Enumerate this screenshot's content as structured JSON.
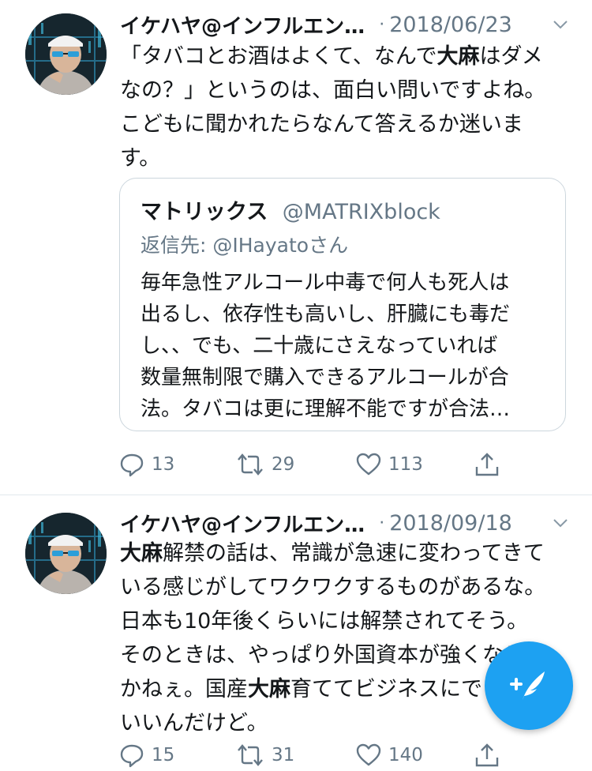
{
  "tweets": [
    {
      "author": "イケハヤ@インフルエン…",
      "sep": "·",
      "date": "2018/06/23",
      "lines": [
        [
          "「タバコとお酒はよくて、なんで",
          "大麻",
          "はダメ"
        ],
        [
          "なの？」というのは、面白い問いですよね。"
        ],
        [
          "こどもに聞かれたらなんて答えるか迷いま"
        ],
        [
          "す。"
        ]
      ],
      "quote": {
        "name": "マトリックス",
        "handle": "@MATRIXblock",
        "reply_prefix": "返信先: ",
        "reply_handle": "@IHayato",
        "reply_suffix": "さん",
        "lines": [
          "毎年急性アルコール中毒で何人も死人は",
          "出るし、依存性も高いし、肝臓にも毒だ",
          "し、、でも、二十歳にさえなっていれば",
          "数量無制限で購入できるアルコールが合",
          "法。タバコは更に理解不能ですが合法…"
        ]
      },
      "replies": "13",
      "retweets": "29",
      "likes": "113"
    },
    {
      "author": "イケハヤ@インフルエン…",
      "sep": "·",
      "date": "2018/09/18",
      "lines": [
        [
          "",
          "大麻",
          "解禁の話は、常識が急速に変わってきて"
        ],
        [
          "いる感じがしてワクワクするものがあるな。"
        ],
        [
          "日本も10年後くらいには解禁されてそう。"
        ],
        [
          "そのときは、やっぱり外国資本が強くなるん"
        ],
        [
          "かねぇ。国産",
          "大麻",
          "育ててビジネスにできたら"
        ],
        [
          "いいんだけど。"
        ]
      ],
      "replies": "15",
      "retweets": "31",
      "likes": "140"
    }
  ],
  "colors": {
    "accent": "#1da1f2",
    "muted": "#657786",
    "text": "#14171a",
    "border": "#ccd6dd"
  },
  "icons": {
    "reply": "reply-icon",
    "retweet": "retweet-icon",
    "like": "heart-icon",
    "share": "share-icon",
    "compose": "compose-tweet-icon"
  }
}
